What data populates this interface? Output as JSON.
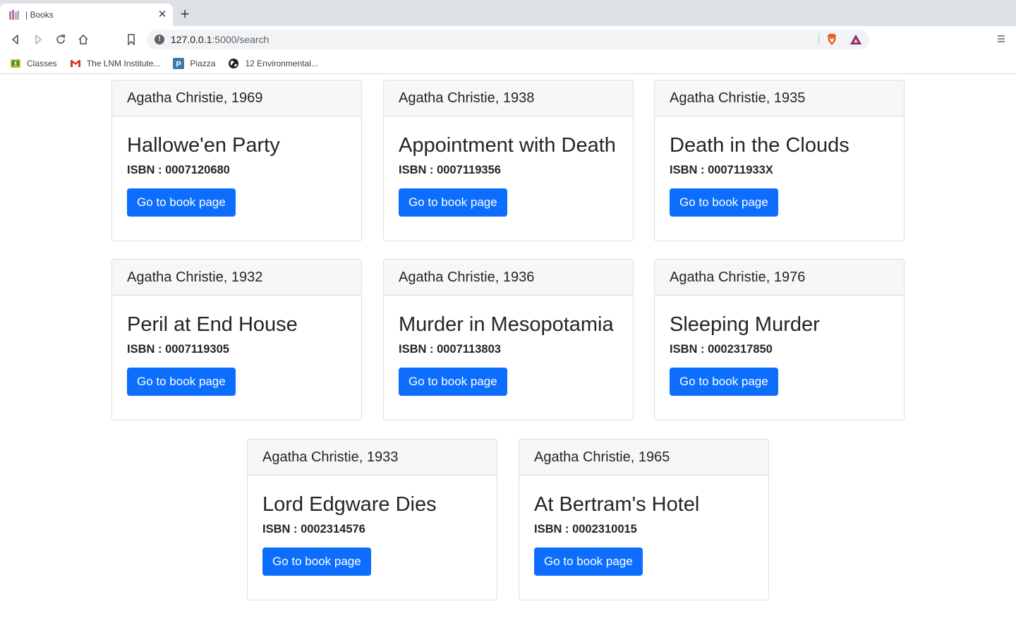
{
  "browser": {
    "tab_title": "| Books",
    "url_host": "127.0.0.1",
    "url_rest": ":5000/search",
    "bookmarks": [
      {
        "label": "Classes",
        "icon": "google-classroom-icon"
      },
      {
        "label": "The LNM Institute...",
        "icon": "gmail-icon"
      },
      {
        "label": "Piazza",
        "icon": "piazza-icon"
      },
      {
        "label": "12 Environmental...",
        "icon": "globe-icon"
      }
    ]
  },
  "colors": {
    "primary_button": "#0d6efd",
    "card_header_bg": "#f7f7f7"
  },
  "books": [
    {
      "header": "Agatha Christie, 1969",
      "title": "Hallowe'en Party",
      "isbn": "ISBN : 0007120680",
      "button": "Go to book page"
    },
    {
      "header": "Agatha Christie, 1938",
      "title": "Appointment with Death",
      "isbn": "ISBN : 0007119356",
      "button": "Go to book page"
    },
    {
      "header": "Agatha Christie, 1935",
      "title": "Death in the Clouds",
      "isbn": "ISBN : 000711933X",
      "button": "Go to book page"
    },
    {
      "header": "Agatha Christie, 1932",
      "title": "Peril at End House",
      "isbn": "ISBN : 0007119305",
      "button": "Go to book page"
    },
    {
      "header": "Agatha Christie, 1936",
      "title": "Murder in Mesopotamia",
      "isbn": "ISBN : 0007113803",
      "button": "Go to book page"
    },
    {
      "header": "Agatha Christie, 1976",
      "title": "Sleeping Murder",
      "isbn": "ISBN : 0002317850",
      "button": "Go to book page"
    },
    {
      "header": "Agatha Christie, 1933",
      "title": "Lord Edgware Dies",
      "isbn": "ISBN : 0002314576",
      "button": "Go to book page"
    },
    {
      "header": "Agatha Christie, 1965",
      "title": "At Bertram's Hotel",
      "isbn": "ISBN : 0002310015",
      "button": "Go to book page"
    }
  ]
}
